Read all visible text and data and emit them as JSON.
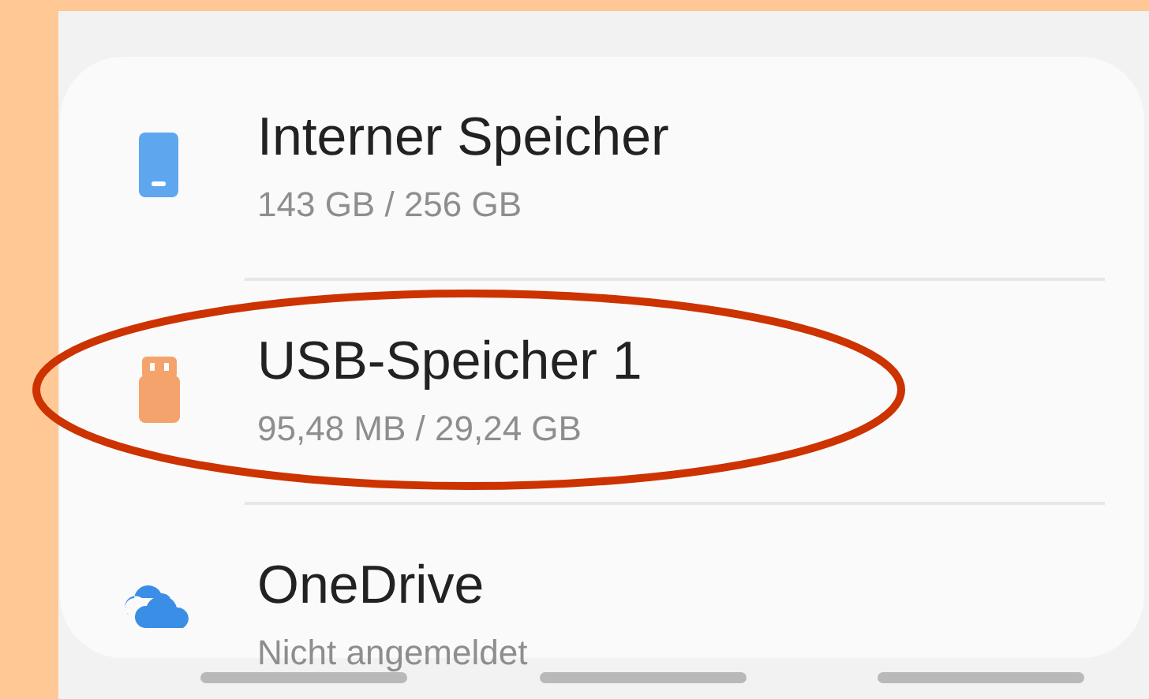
{
  "storage_items": [
    {
      "kind": "phone",
      "title": "Interner Speicher",
      "subtitle": "143 GB / 256 GB",
      "highlighted": false
    },
    {
      "kind": "usb",
      "title": "USB-Speicher 1",
      "subtitle": "95,48 MB / 29,24 GB",
      "highlighted": true
    },
    {
      "kind": "cloud",
      "title": "OneDrive",
      "subtitle": "Nicht angemeldet",
      "highlighted": false
    }
  ]
}
